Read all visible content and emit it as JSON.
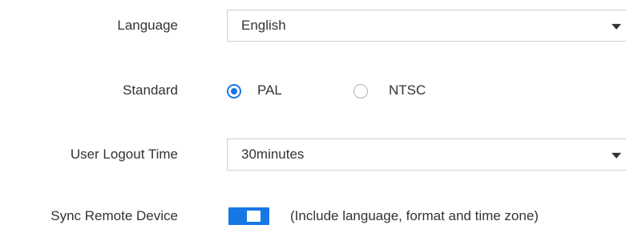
{
  "language": {
    "label": "Language",
    "value": "English",
    "caret_icon": "caret-down-icon"
  },
  "standard": {
    "label": "Standard",
    "options": [
      {
        "label": "PAL",
        "checked": true
      },
      {
        "label": "NTSC",
        "checked": false
      }
    ]
  },
  "user_logout_time": {
    "label": "User Logout Time",
    "value": "30minutes",
    "caret_icon": "caret-down-icon"
  },
  "sync_remote_device": {
    "label": "Sync Remote Device",
    "enabled": true,
    "hint": "(Include language, format and time zone)"
  },
  "colors": {
    "accent": "#1677e5",
    "text": "#333333",
    "border": "#cfcfcf"
  }
}
